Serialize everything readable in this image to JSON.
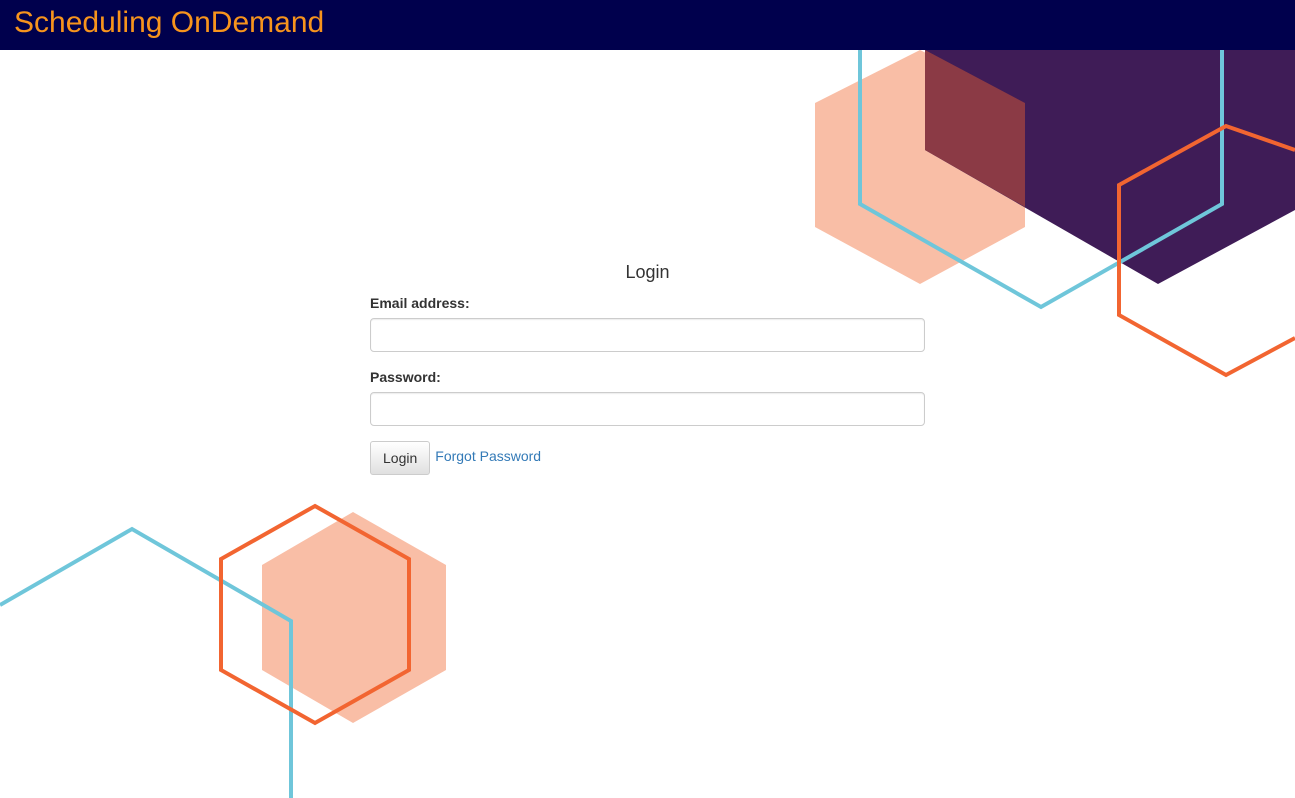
{
  "header": {
    "brand": "Scheduling OnDemand",
    "background_color": "#00004d",
    "brand_color": "#f7941d"
  },
  "login": {
    "title": "Login",
    "email_label": "Email address:",
    "email_value": "",
    "password_label": "Password:",
    "password_value": "",
    "submit_label": "Login",
    "forgot_label": "Forgot Password"
  },
  "decor_colors": {
    "peach": "#f9bea6",
    "purple": "#3f1c57",
    "maroon": "#8b3a45",
    "orange_outline": "#f26531",
    "blue_outline": "#6fc6da"
  }
}
